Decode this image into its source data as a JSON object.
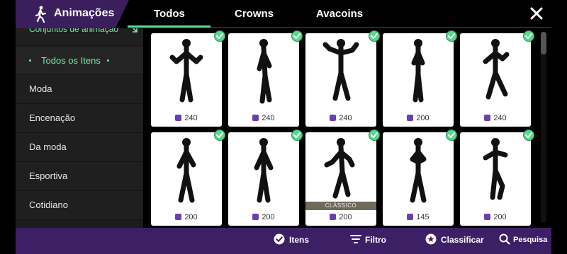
{
  "header": {
    "title": "Animações",
    "tabs": [
      {
        "label": "Todos",
        "active": true
      },
      {
        "label": "Crowns",
        "active": false
      },
      {
        "label": "Avacoins",
        "active": false
      }
    ]
  },
  "sidebar": {
    "top_label": "Conjuntos de animação",
    "items": [
      {
        "label": "Todos os Itens",
        "active": true
      },
      {
        "label": "Moda",
        "active": false
      },
      {
        "label": "Encenação",
        "active": false
      },
      {
        "label": "Da moda",
        "active": false
      },
      {
        "label": "Esportiva",
        "active": false
      },
      {
        "label": "Cotidiano",
        "active": false
      }
    ]
  },
  "items": [
    {
      "price": "240",
      "owned": true,
      "badge": ""
    },
    {
      "price": "240",
      "owned": true,
      "badge": ""
    },
    {
      "price": "240",
      "owned": true,
      "badge": ""
    },
    {
      "price": "200",
      "owned": true,
      "badge": ""
    },
    {
      "price": "240",
      "owned": true,
      "badge": ""
    },
    {
      "price": "200",
      "owned": true,
      "badge": ""
    },
    {
      "price": "200",
      "owned": true,
      "badge": ""
    },
    {
      "price": "200",
      "owned": true,
      "badge": "CLÁSSICO"
    },
    {
      "price": "145",
      "owned": true,
      "badge": ""
    },
    {
      "price": "200",
      "owned": true,
      "badge": ""
    }
  ],
  "bottom": {
    "items_label": "Itens",
    "filter_label": "Filtro",
    "sort_label": "Classificar",
    "search_label": "Pesquisa"
  },
  "colors": {
    "accent_green": "#5fe09a",
    "purple_bar": "#3d1f66",
    "coin_purple": "#6a3fb0"
  },
  "icons": [
    "dancer-icon",
    "close-icon",
    "check-icon",
    "coin-icon",
    "filter-icon",
    "sort-icon",
    "search-icon",
    "collapse-icon"
  ]
}
